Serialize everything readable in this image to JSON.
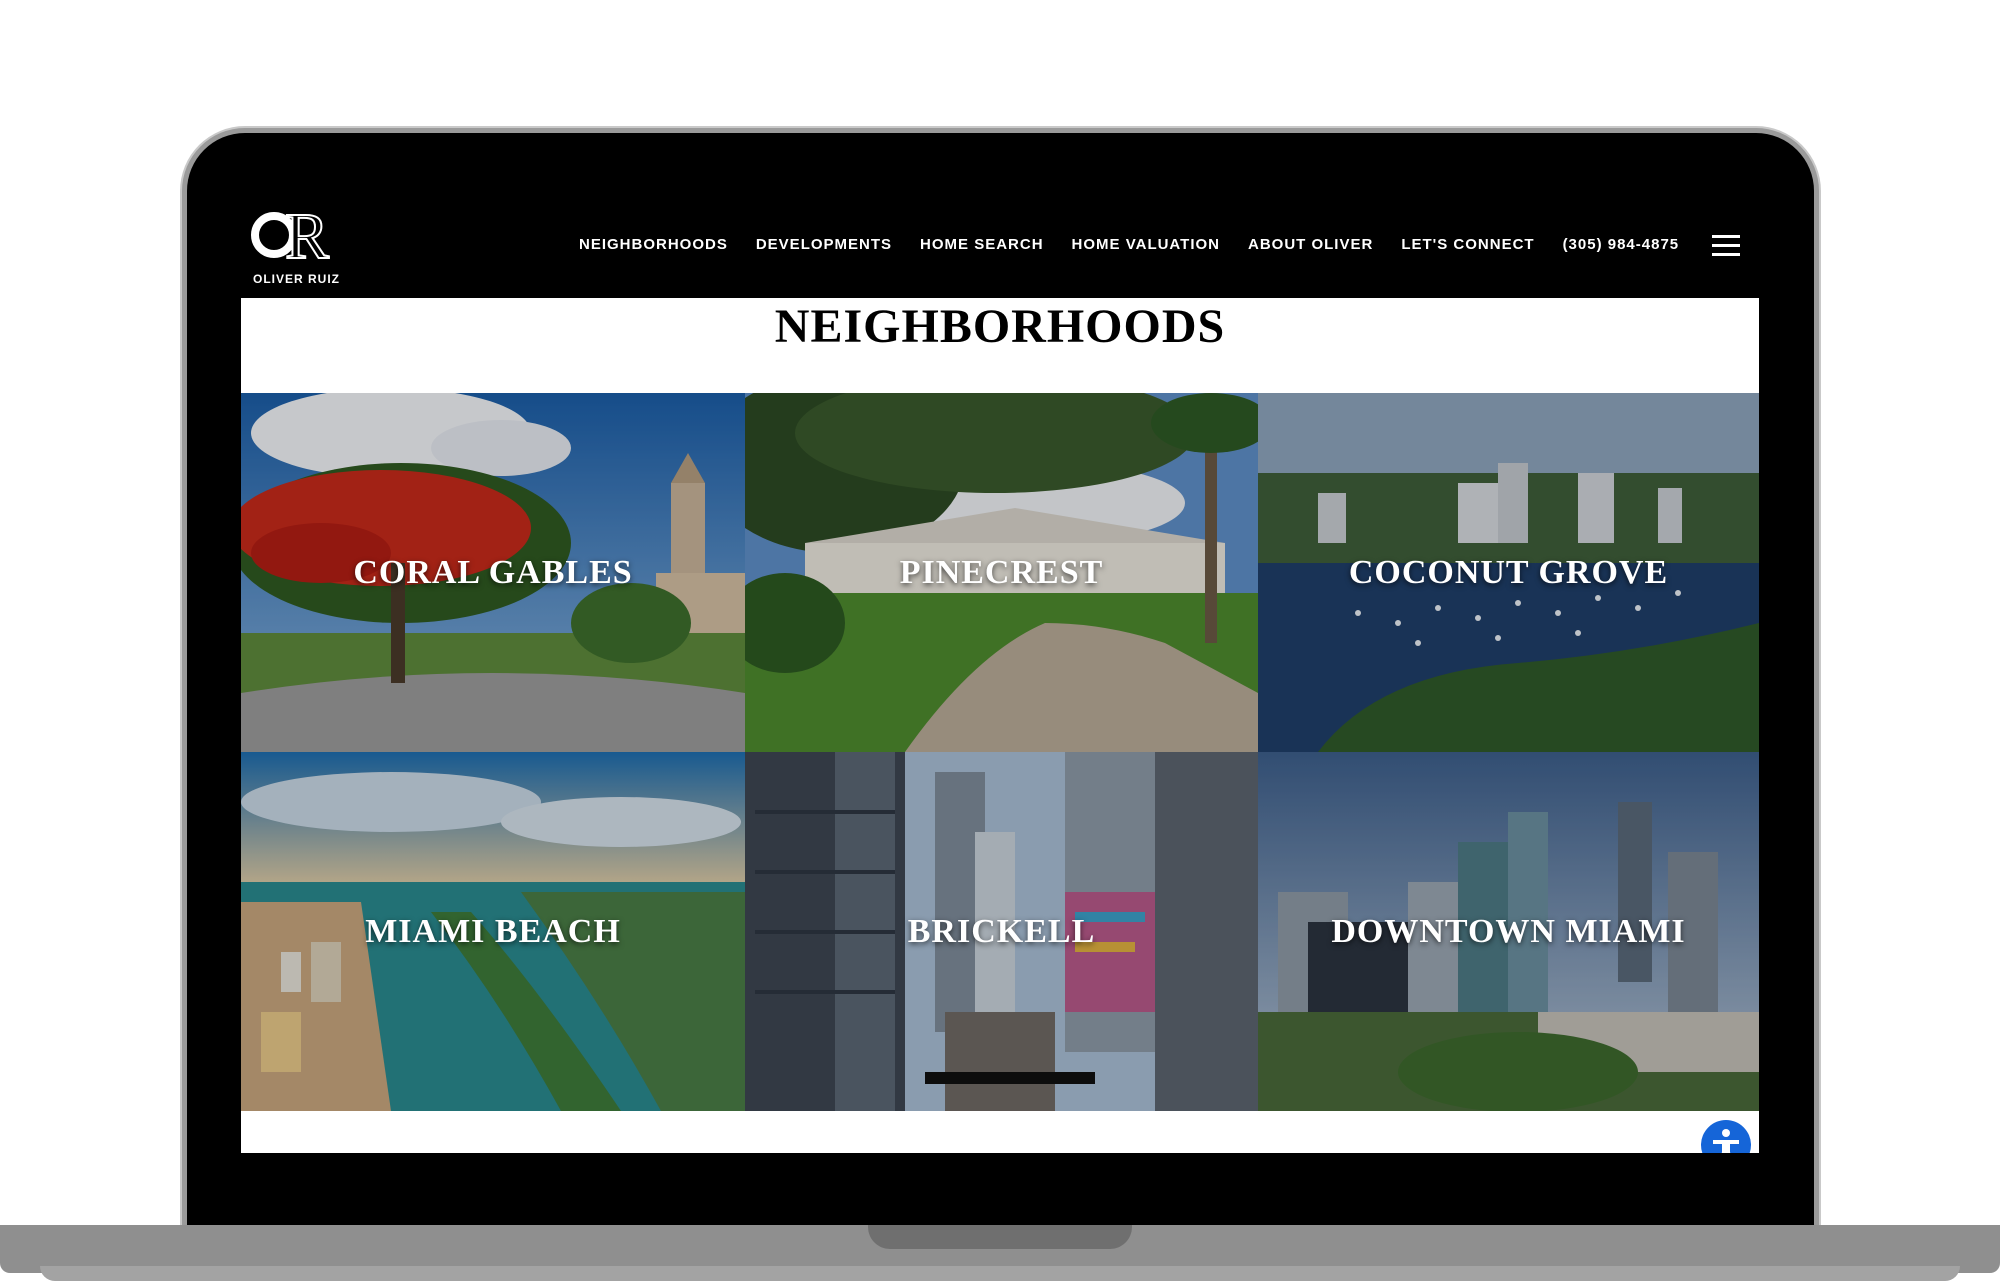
{
  "brand": {
    "name": "OLIVER RUIZ"
  },
  "nav": {
    "items": [
      {
        "label": "NEIGHBORHOODS"
      },
      {
        "label": "DEVELOPMENTS"
      },
      {
        "label": "HOME SEARCH"
      },
      {
        "label": "HOME VALUATION"
      },
      {
        "label": "ABOUT OLIVER"
      },
      {
        "label": "LET'S CONNECT"
      },
      {
        "label": "(305) 984-4875"
      }
    ]
  },
  "page": {
    "title": "NEIGHBORHOODS"
  },
  "neighborhoods": [
    {
      "label": "CORAL GABLES"
    },
    {
      "label": "PINECREST"
    },
    {
      "label": "COCONUT GROVE"
    },
    {
      "label": "MIAMI BEACH"
    },
    {
      "label": "BRICKELL"
    },
    {
      "label": "DOWNTOWN MIAMI"
    }
  ],
  "colors": {
    "nav_bg": "#000000",
    "accessibility_button": "#1565d8"
  },
  "icons": [
    "hamburger-menu-icon",
    "accessibility-icon"
  ]
}
